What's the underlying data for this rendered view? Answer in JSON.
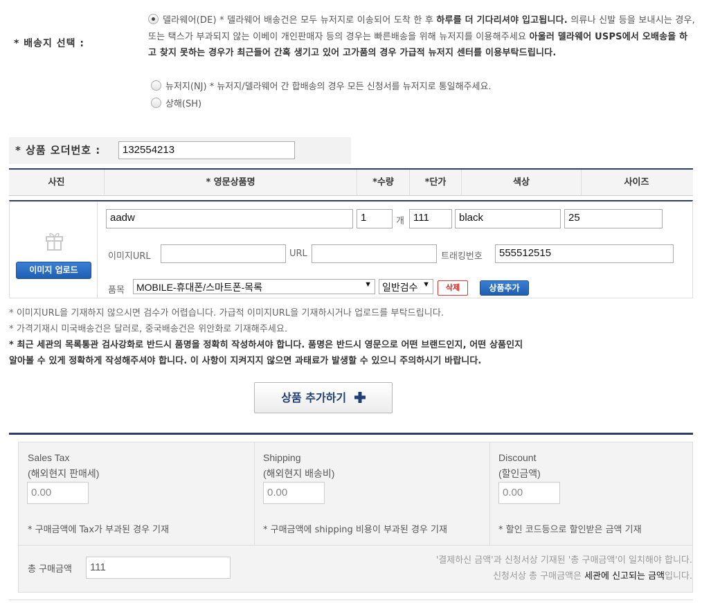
{
  "shipping": {
    "label": "* 배송지 선택 :",
    "options": [
      {
        "value": "DE",
        "selected": true,
        "text_a": "델라웨어(DE) * 델라웨어 배송건은 모두 뉴저지로 이송되어 도착 한 후 ",
        "text_b": "하루를 더 기다리셔야 입고됩니다.",
        "text_c": " 의류나 신발 등을 보내시는 경우, 또는 택스가 부과되지 않는 이베이 개인판매자 등의 경우는 빠른배송을 위해 뉴저지를 이용해주세요 ",
        "text_d": "아울러 델라웨어 USPS에서 오배송을 하고 찾지 못하는 경우가 최근들어 간혹 생기고 있어 고가품의 경우 가급적 뉴저지 센터를 이용부탁드립니다."
      },
      {
        "value": "NJ",
        "selected": false,
        "text": "뉴저지(NJ) * 뉴저지/델라웨어 간 합배송의 경우 모든 신청서를 뉴저지로 통일해주세요."
      },
      {
        "value": "SH",
        "selected": false,
        "text": "상해(SH)"
      }
    ]
  },
  "order": {
    "label": "* 상품 오더번호 :",
    "value": "132554213"
  },
  "table": {
    "headers": [
      "사진",
      "* 영문상품명",
      "*수량",
      "*단가",
      "색상",
      "사이즈"
    ]
  },
  "product": {
    "icon": "gift-icon",
    "upload_label": "이미지 업로드",
    "name": "aadw",
    "qty": "1",
    "qty_unit": "개",
    "price": "111",
    "color": "black",
    "size": "25",
    "image_url_label": "이미지URL",
    "image_url": "",
    "url_label": "URL",
    "url": "",
    "tracking_label": "트래킹번호",
    "tracking": "555512515",
    "category_label": "품목",
    "category": "MOBILE-휴대폰/스마트폰-목록",
    "inspection": "일반검수",
    "delete_label": "삭제",
    "add_label": "상품추가"
  },
  "notes": [
    "* 이미지URL을 기재하지 않으시면 검수가 어렵습니다. 가급적 이미지URL을 기재하시거나 업로드를 부탁드립니다.",
    "* 가격기재시 미국배송건은 달러로, 중국배송건은 위안화로 기재해주세요.",
    "* 최근 세관의 목록통관 검사강화로 반드시 품명을 정확히 작성하셔야 합니다. 품명은 반드시 영문으로 어떤 브랜드인지, 어떤 상품인지",
    "알아볼 수 있게 정확하게 작성해주셔야 합니다. 이 사항이 지켜지지 않으면 과태료가 발생할 수 있으니 주의하시기 바랍니다."
  ],
  "add_product_big": {
    "label": "상품 추가하기",
    "icon": "plus-icon"
  },
  "totals": {
    "sales_tax": {
      "title": "Sales Tax",
      "subtitle": "(해외현지 판매세)",
      "value": "0.00",
      "note": "* 구매금액에 Tax가 부과된 경우 기재"
    },
    "shipping": {
      "title": "Shipping",
      "subtitle": "(해외현지 배송비)",
      "value": "0.00",
      "note": "* 구매금액에 shipping 비용이 부과된 경우 기재"
    },
    "discount": {
      "title": "Discount",
      "subtitle": "(할인금액)",
      "value": "0.00",
      "note": "* 할인 코드등으로 할인받은 금액 기재"
    },
    "total_label": "총 구매금액",
    "total_value": "111",
    "info_line1": "'결제하신 금액'과 신청서상 기재된 '총 구매금액'이 일치해야 합니다.",
    "info_line2_a": "신청서상 총 구매금액은 ",
    "info_line2_b": "세관에 신고되는 금액",
    "info_line2_c": "입니다."
  }
}
